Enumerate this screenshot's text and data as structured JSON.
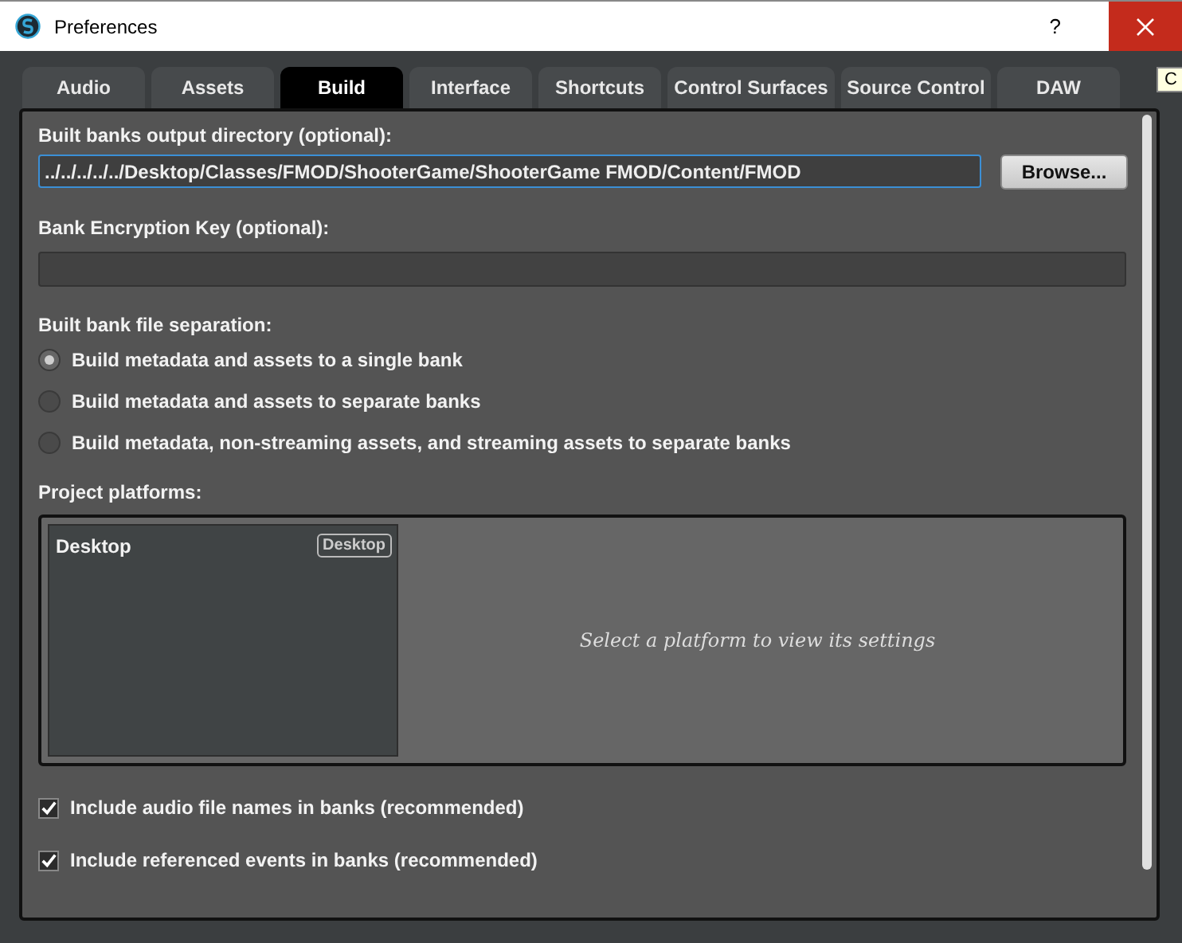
{
  "window": {
    "title": "Preferences",
    "help": "?",
    "tooltip": "C"
  },
  "tabs": [
    {
      "label": "Audio",
      "selected": false
    },
    {
      "label": "Assets",
      "selected": false
    },
    {
      "label": "Build",
      "selected": true
    },
    {
      "label": "Interface",
      "selected": false
    },
    {
      "label": "Shortcuts",
      "selected": false
    },
    {
      "label": "Control Surfaces",
      "selected": false
    },
    {
      "label": "Source Control",
      "selected": false
    },
    {
      "label": "DAW",
      "selected": false
    }
  ],
  "output_directory": {
    "label": "Built banks output directory (optional):",
    "value": "../../../../../Desktop/Classes/FMOD/ShooterGame/ShooterGame FMOD/Content/FMOD",
    "button": "Browse..."
  },
  "encryption_key": {
    "label": "Bank Encryption Key (optional):"
  },
  "separation": {
    "label": "Built bank file separation:",
    "options": [
      {
        "label": "Build metadata and assets to a single bank",
        "selected": true
      },
      {
        "label": "Build metadata and assets to separate banks",
        "selected": false
      },
      {
        "label": "Build metadata, non-streaming assets, and streaming assets to separate banks",
        "selected": false
      }
    ]
  },
  "platforms": {
    "label": "Project platforms:",
    "items": [
      {
        "name": "Desktop",
        "tag": "Desktop",
        "selected": false
      }
    ],
    "hint": "Select a platform to view its settings"
  },
  "options": [
    {
      "label": "Include audio file names in banks (recommended)",
      "checked": true
    },
    {
      "label": "Include referenced events in banks (recommended)",
      "checked": true
    }
  ]
}
